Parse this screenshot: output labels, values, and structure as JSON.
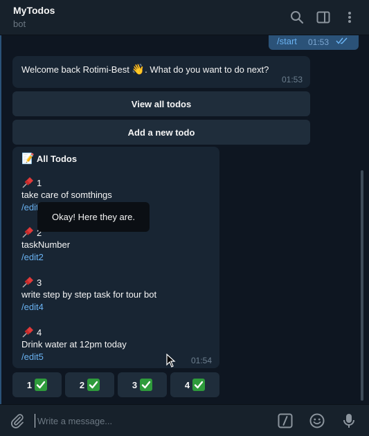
{
  "header": {
    "title": "MyTodos",
    "subtitle": "bot",
    "icons": [
      "search-icon",
      "sidebar-toggle-icon",
      "more-vertical-icon"
    ]
  },
  "messages": {
    "outgoing": {
      "text": "/start",
      "time": "01:53"
    },
    "welcome": {
      "text_before": "Welcome back Rotimi-Best ",
      "emoji": "👋",
      "text_after": ". What do you want to do next?",
      "time": "01:53"
    },
    "keyboard": {
      "view_all": "View all todos",
      "add_new": "Add a new todo"
    },
    "todos": {
      "heading_emoji": "📝",
      "heading": "All Todos",
      "items": [
        {
          "number": "1",
          "text": "take care of somthings",
          "link": "/edit1"
        },
        {
          "number": "2",
          "text": "taskNumber",
          "link": "/edit2"
        },
        {
          "number": "3",
          "text": "write step by step task for tour bot",
          "link": "/edit4"
        },
        {
          "number": "4",
          "text": "Drink water at 12pm today",
          "link": "/edit5"
        }
      ],
      "time": "01:54"
    },
    "toast": "Okay! Here they are.",
    "number_buttons": [
      "1",
      "2",
      "3",
      "4"
    ]
  },
  "composer": {
    "placeholder": "Write a message...",
    "icons": [
      "attach-icon",
      "bot-command-icon",
      "emoji-icon",
      "microphone-icon"
    ]
  },
  "colors": {
    "background": "#0e1621",
    "panel": "#17212b",
    "bubble_in": "#182533",
    "bubble_out": "#2b5278",
    "link": "#6ab3f3",
    "check_green": "#2e9b3b"
  }
}
